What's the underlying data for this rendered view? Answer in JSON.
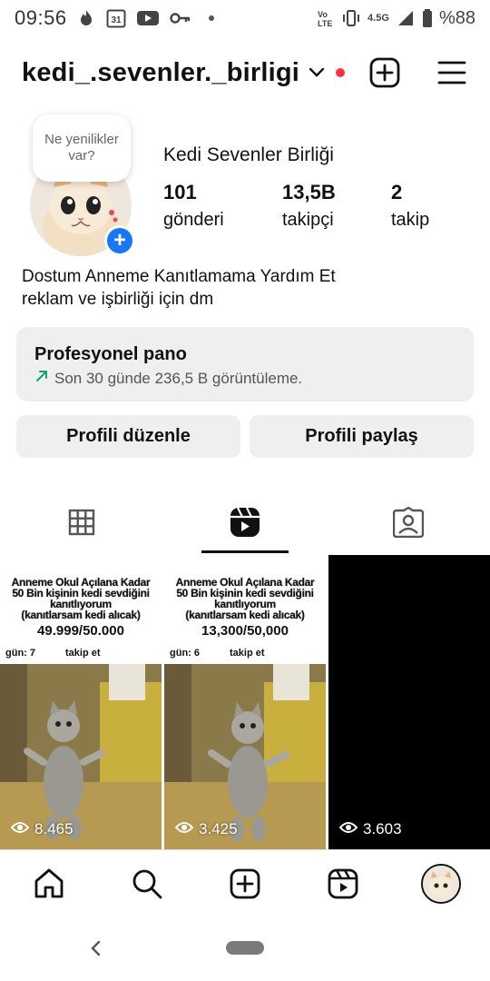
{
  "status_bar": {
    "time": "09:56",
    "calendar_day": "31",
    "network": "4.5G",
    "battery": "%88",
    "icons": [
      "fire-icon",
      "calendar-icon",
      "youtube-icon",
      "key-icon",
      "dot-icon",
      "volte-icon",
      "vibrate-icon",
      "signal-icon",
      "battery-icon"
    ]
  },
  "header": {
    "username": "kedi_.sevenler._birligi",
    "notification_dot_color": "#ff3040"
  },
  "profile": {
    "note_text": "Ne yenilikler var?",
    "display_name": "Kedi Sevenler Birliği",
    "stats": [
      {
        "value": "101",
        "label": "gönderi"
      },
      {
        "value": "13,5B",
        "label": "takipçi"
      },
      {
        "value": "2",
        "label": "takip"
      }
    ],
    "bio_line1": "Dostum Anneme Kanıtlamama Yardım Et",
    "bio_line2": "reklam ve işbirliği için dm"
  },
  "pro_dashboard": {
    "title": "Profesyonel pano",
    "subtitle": "Son 30 günde 236,5 B görüntüleme."
  },
  "buttons": {
    "edit_profile": "Profili düzenle",
    "share_profile": "Profili paylaş"
  },
  "tabs": [
    "grid-icon",
    "reels-icon",
    "tagged-icon"
  ],
  "grid": [
    {
      "caption_line1": "Anneme Okul Açılana Kadar",
      "caption_line2": "50 Bin kişinin kedi sevdiğini",
      "caption_line3": "kanıtlıyorum",
      "caption_line4": "(kanıtlarsam kedi alıcak)",
      "count": "49.999/50.000",
      "day": "gün: 7",
      "follow": "takip et",
      "views": "8.465"
    },
    {
      "caption_line1": "Anneme Okul Açılana Kadar",
      "caption_line2": "50 Bin kişinin kedi sevdiğini",
      "caption_line3": "kanıtlıyorum",
      "caption_line4": "(kanıtlarsam kedi alıcak)",
      "count": "13,300/50,000",
      "day": "gün: 6",
      "follow": "takip et",
      "views": "3.425"
    },
    {
      "views": "3.603"
    }
  ],
  "bottom_nav": [
    "home-icon",
    "search-icon",
    "create-icon",
    "reels-icon",
    "profile-avatar"
  ],
  "colors": {
    "accent_blue": "#1877f2",
    "panel_gray": "#efefef",
    "trend_green": "#14a06f"
  }
}
